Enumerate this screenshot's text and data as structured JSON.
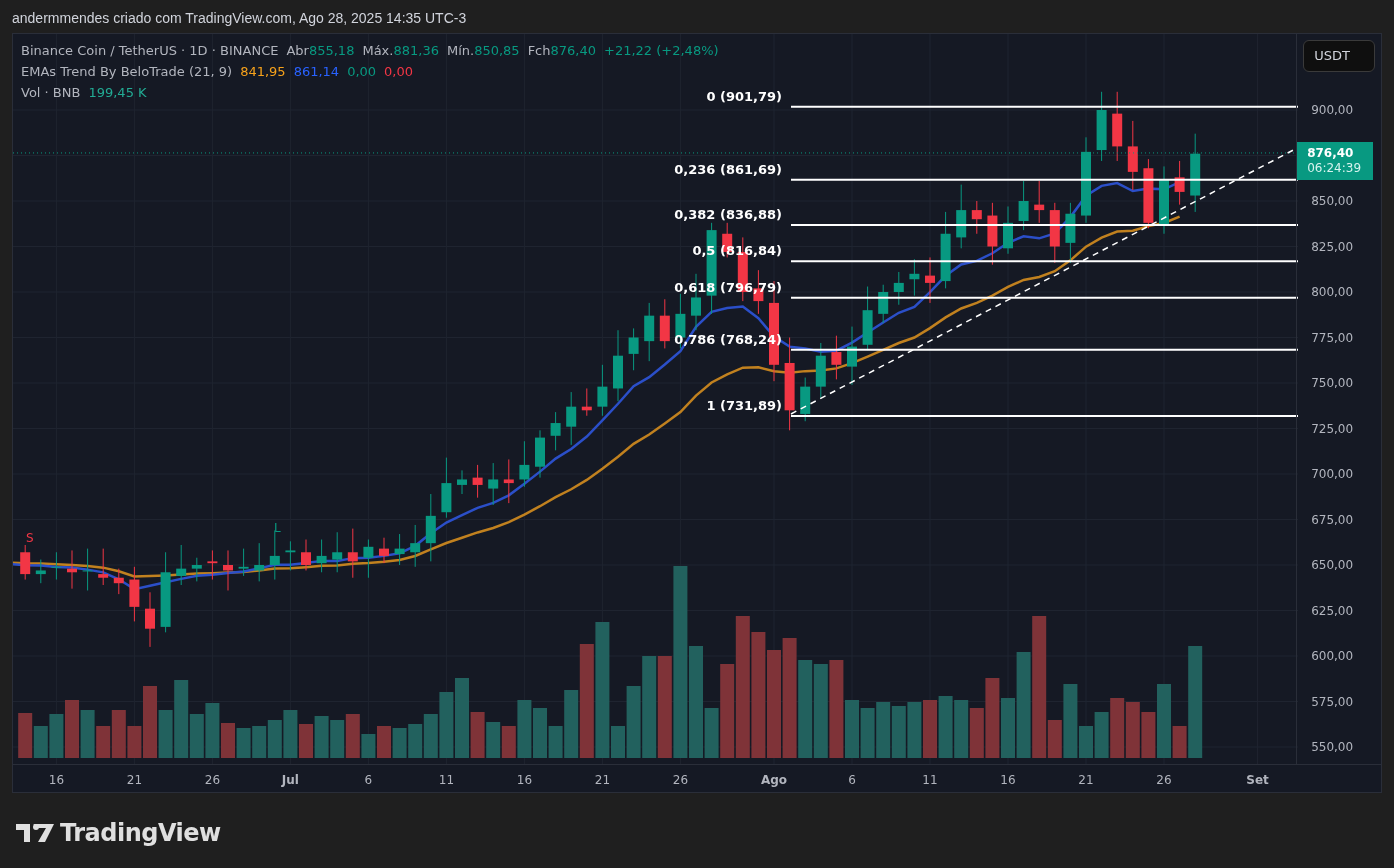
{
  "caption": "andermmendes criado com TradingView.com, Ago 28, 2025 14:35 UTC-3",
  "legend": {
    "title": "Binance Coin / TetherUS · 1D · BINANCE",
    "ohlc": [
      {
        "label": "Abr",
        "value": "855,18"
      },
      {
        "label": "Máx.",
        "value": "881,36"
      },
      {
        "label": "Mín.",
        "value": "850,85"
      },
      {
        "label": "Fch",
        "value": "876,40"
      }
    ],
    "change": "+21,22 (+2,48%)",
    "indicator": {
      "name": "EMAs Trend By BeloTrade (21, 9)",
      "values": [
        {
          "text": "841,95",
          "color": "#f7a21b"
        },
        {
          "text": "861,14",
          "color": "#2962ff"
        },
        {
          "text": "0,00",
          "color": "#089981"
        },
        {
          "text": "0,00",
          "color": "#f23645"
        }
      ]
    },
    "volume": {
      "name": "Vol · BNB",
      "value": "199,45 K"
    }
  },
  "currency_button": "USDT",
  "fib_levels": [
    {
      "label": "0 (901,79)"
    },
    {
      "label": "0,236 (861,69)"
    },
    {
      "label": "0,382 (836,88)"
    },
    {
      "label": "0,5 (816,84)"
    },
    {
      "label": "0,618 (796,79)"
    },
    {
      "label": "0,786 (768,24)"
    },
    {
      "label": "1 (731,89)"
    }
  ],
  "signals": [
    {
      "text": "S",
      "kind": "sell"
    },
    {
      "text": "L",
      "kind": "buy"
    }
  ],
  "price_axis": [
    "900,00",
    "850,00",
    "825,00",
    "800,00",
    "775,00",
    "750,00",
    "725,00",
    "700,00",
    "675,00",
    "650,00",
    "625,00",
    "600,00",
    "575,00",
    "550,00"
  ],
  "price_tag": {
    "price": "876,40",
    "countdown": "06:24:39"
  },
  "time_axis": [
    {
      "label": "16",
      "kind": "day"
    },
    {
      "label": "21",
      "kind": "day"
    },
    {
      "label": "26",
      "kind": "day"
    },
    {
      "label": "Jul",
      "kind": "month"
    },
    {
      "label": "6",
      "kind": "day"
    },
    {
      "label": "11",
      "kind": "day"
    },
    {
      "label": "16",
      "kind": "day"
    },
    {
      "label": "21",
      "kind": "day"
    },
    {
      "label": "26",
      "kind": "day"
    },
    {
      "label": "Ago",
      "kind": "month"
    },
    {
      "label": "6",
      "kind": "day"
    },
    {
      "label": "11",
      "kind": "day"
    },
    {
      "label": "16",
      "kind": "day"
    },
    {
      "label": "21",
      "kind": "day"
    },
    {
      "label": "26",
      "kind": "day"
    },
    {
      "label": "Set",
      "kind": "month"
    }
  ],
  "logo": "TradingView"
}
